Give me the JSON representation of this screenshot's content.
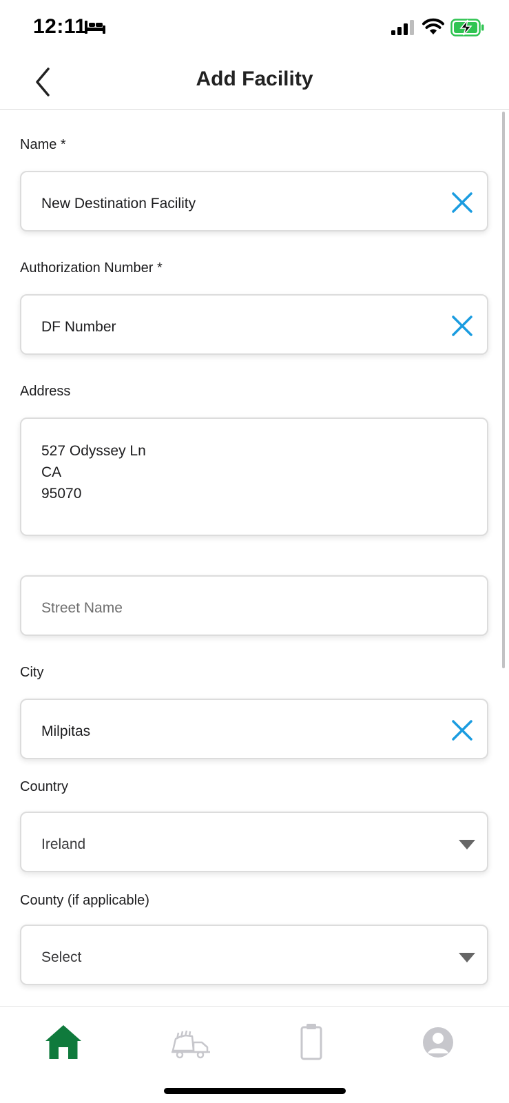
{
  "status_bar": {
    "time": "12:11"
  },
  "nav": {
    "title": "Add Facility"
  },
  "form": {
    "name": {
      "label": "Name *",
      "value": "New Destination Facility"
    },
    "authorization": {
      "label": "Authorization Number *",
      "value": "DF Number"
    },
    "address": {
      "label": "Address",
      "lines": [
        "527 Odyssey Ln",
        "CA",
        "95070"
      ]
    },
    "street": {
      "placeholder": "Street Name"
    },
    "city": {
      "label": "City",
      "value": "Milpitas"
    },
    "country": {
      "label": "Country",
      "value": "Ireland"
    },
    "county": {
      "label": "County (if applicable)",
      "value": "Select"
    }
  },
  "colors": {
    "accent_blue": "#1a9ce0",
    "brand_green": "#0f7a3c",
    "inactive_gray": "#c7c7cc"
  },
  "tabs": [
    {
      "icon": "home-icon",
      "active": true
    },
    {
      "icon": "truck-icon",
      "active": false
    },
    {
      "icon": "clipboard-icon",
      "active": false
    },
    {
      "icon": "profile-icon",
      "active": false
    }
  ]
}
